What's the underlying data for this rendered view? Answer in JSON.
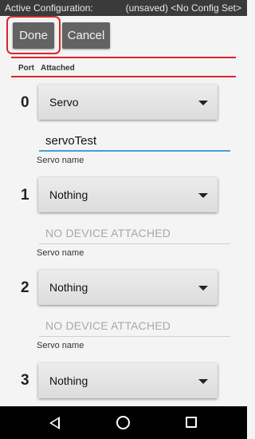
{
  "status_bar": {
    "left_text": "Active Configuration:",
    "right_text": "(unsaved) <No Config Set>"
  },
  "toolbar": {
    "done_label": "Done",
    "cancel_label": "Cancel"
  },
  "table_header": {
    "port": "Port",
    "attached": "Attached"
  },
  "ports": [
    {
      "number": "0",
      "device": "Servo",
      "name_value": "servoTest",
      "name_hint": "Servo name"
    },
    {
      "number": "1",
      "device": "Nothing",
      "name_value": "NO DEVICE ATTACHED",
      "name_hint": "Servo name"
    },
    {
      "number": "2",
      "device": "Nothing",
      "name_value": "NO DEVICE ATTACHED",
      "name_hint": "Servo name"
    },
    {
      "number": "3",
      "device": "Nothing"
    }
  ],
  "nav_bar": {
    "icons": [
      "back-icon",
      "home-icon",
      "recents-icon"
    ]
  },
  "colors": {
    "accent_red": "#d9262c",
    "focus_blue": "#4a9dd6",
    "button_gray": "#636363",
    "status_bar": "#3a3a3a"
  }
}
